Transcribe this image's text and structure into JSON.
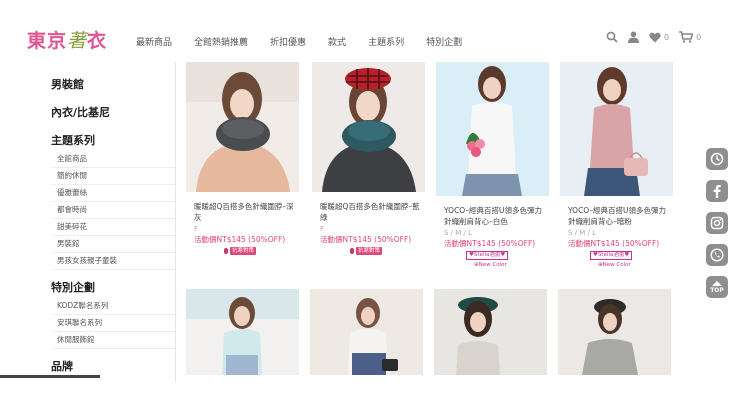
{
  "brand": {
    "logo_main": "東京",
    "logo_leaf": "著",
    "logo_tail": "衣"
  },
  "nav": [
    "最新商品",
    "全館熱銷推薦",
    "折扣優惠",
    "款式",
    "主題系列",
    "特別企劃"
  ],
  "tools": {
    "search_icon": "search-icon",
    "user_icon": "user-icon",
    "wishlist_count": "0",
    "cart_count": "0"
  },
  "sidebar": {
    "sections": [
      {
        "title": "男裝館",
        "items": []
      },
      {
        "title": "內衣/比基尼",
        "items": []
      },
      {
        "title": "主題系列",
        "items": [
          "全館商品",
          "簡約休閒",
          "優雅蕾絲",
          "都會時尚",
          "甜美碎花",
          "男裝館",
          "男孩女孩親子童裝"
        ]
      },
      {
        "title": "特別企劃",
        "items": [
          "KODZ聯名系列",
          "安琪聯名系列",
          "休閒服飾館"
        ]
      },
      {
        "title": "品牌",
        "items": []
      }
    ]
  },
  "products": [
    {
      "name": "暖暖超Q百搭多色針織圍脖–深灰",
      "sizes": "F",
      "price": "活動價NT$145 (50%OFF)",
      "tag": "抗寒對策",
      "new_color": ""
    },
    {
      "name": "暖暖超Q百搭多色針織圍脖–藍綠",
      "sizes": "F",
      "price": "活動價NT$145 (50%OFF)",
      "tag": "抗寒對策",
      "new_color": ""
    },
    {
      "name": "YOCO–經典百搭U領多色彈力針織削肩背心–白色",
      "sizes": "S / M / L",
      "price": "活動價NT$145 (50%OFF)",
      "tag": "♥Stella酒蕾♥",
      "new_color": "⊕New Color"
    },
    {
      "name": "YOCO–經典百搭U領多色彈力針織削肩背心–暗粉",
      "sizes": "S / M / L",
      "price": "活動價NT$145 (50%OFF)",
      "tag": "♥Stella酒蕾♥",
      "new_color": "⊕New Color"
    }
  ],
  "floating": {
    "top_label": "TOP"
  },
  "colors": {
    "brand_pink": "#e0548f",
    "price_pink": "#e2457a",
    "floating_gray": "#8f8f8f"
  }
}
